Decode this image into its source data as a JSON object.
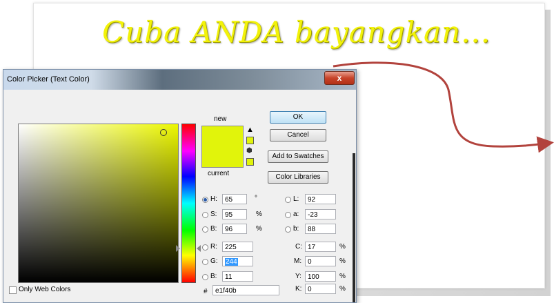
{
  "slide": {
    "title": "Cuba ANDA bayangkan...",
    "title_color": "#f2f20a",
    "arrow_color": "#b2433d"
  },
  "dialog": {
    "title": "Color Picker (Text Color)",
    "close_glyph": "x",
    "new_label": "new",
    "current_label": "current",
    "swatch_color": "#e1f40b",
    "buttons": {
      "ok": "OK",
      "cancel": "Cancel",
      "add_to_swatches": "Add to Swatches",
      "color_libraries": "Color Libraries"
    },
    "hsb": {
      "h_label": "H:",
      "h_value": "65",
      "h_unit": "°",
      "s_label": "S:",
      "s_value": "95",
      "s_unit": "%",
      "b_label": "B:",
      "b_value": "96",
      "b_unit": "%"
    },
    "rgb": {
      "r_label": "R:",
      "r_value": "225",
      "g_label": "G:",
      "g_value": "244",
      "b_label": "B:",
      "b_value": "11"
    },
    "lab": {
      "l_label": "L:",
      "l_value": "92",
      "a_label": "a:",
      "a_value": "-23",
      "b_label": "b:",
      "b_value": "88"
    },
    "cmyk": {
      "c_label": "C:",
      "c_value": "17",
      "c_unit": "%",
      "m_label": "M:",
      "m_value": "0",
      "m_unit": "%",
      "y_label": "Y:",
      "y_value": "100",
      "y_unit": "%",
      "k_label": "K:",
      "k_value": "0",
      "k_unit": "%"
    },
    "hex_label": "#",
    "hex_value": "e1f40b",
    "only_web_colors": "Only Web Colors",
    "selected_mode": "H"
  }
}
